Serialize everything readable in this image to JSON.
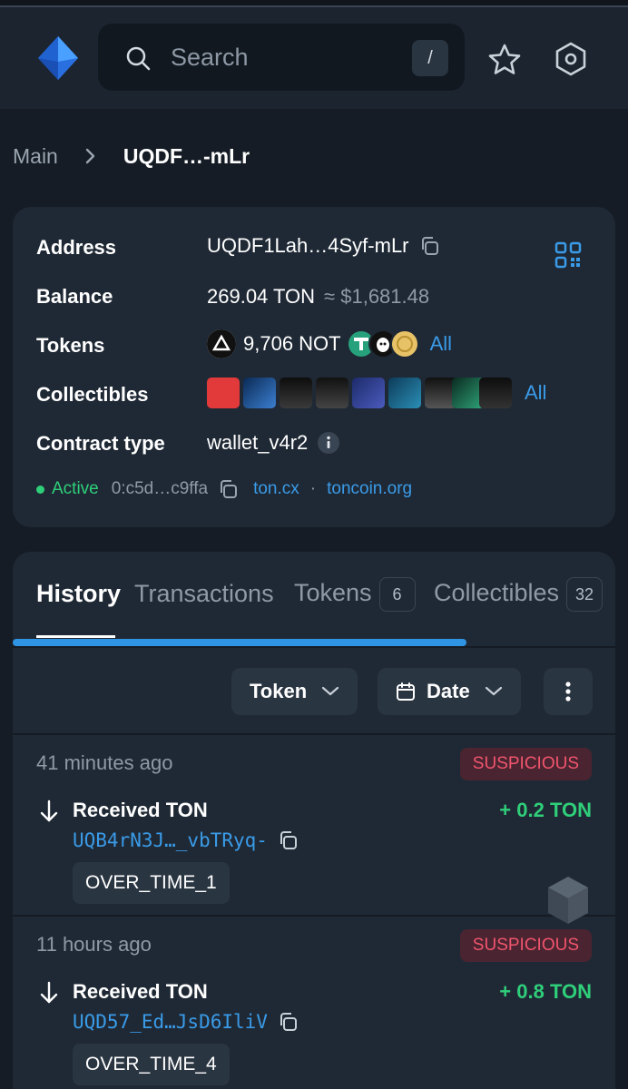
{
  "header": {
    "search_placeholder": "Search",
    "search_shortcut": "/"
  },
  "breadcrumb": {
    "root": "Main",
    "current": "UQDF…-mLr"
  },
  "account": {
    "address_label": "Address",
    "address": "UQDF1Lah…4Syf-mLr",
    "balance_label": "Balance",
    "balance": "269.04 TON",
    "balance_usd": "≈ $1,681.48",
    "tokens_label": "Tokens",
    "token_main": "9,706 NOT",
    "tokens_all": "All",
    "collectibles_label": "Collectibles",
    "collectibles_all": "All",
    "contract_label": "Contract type",
    "contract_type": "wallet_v4r2",
    "status": "Active",
    "raw_address": "0:c5d…c9ffa",
    "link_toncx": "ton.cx",
    "link_sep": "·",
    "link_toncoin": "toncoin.org"
  },
  "tabs": [
    {
      "label": "History"
    },
    {
      "label": "Transactions"
    },
    {
      "label": "Tokens",
      "count": "6"
    },
    {
      "label": "Collectibles",
      "count": "32"
    }
  ],
  "filters": {
    "token": "Token",
    "date": "Date"
  },
  "transactions": [
    {
      "time": "41 minutes ago",
      "badge": "SUSPICIOUS",
      "title": "Received TON",
      "amount": "+ 0.2 TON",
      "address": "UQB4rN3J…_vbTRyq-",
      "comment": "OVER_TIME_1"
    },
    {
      "time": "11 hours ago",
      "badge": "SUSPICIOUS",
      "title": "Received TON",
      "amount": "+ 0.8 TON",
      "address": "UQD57_Ed…JsD6IliV",
      "comment": "OVER_TIME_4"
    }
  ],
  "colors": {
    "accent": "#3a9be8",
    "positive": "#2fcf7a",
    "danger": "#f0556e",
    "card": "#1f2935",
    "background": "#151c25"
  }
}
